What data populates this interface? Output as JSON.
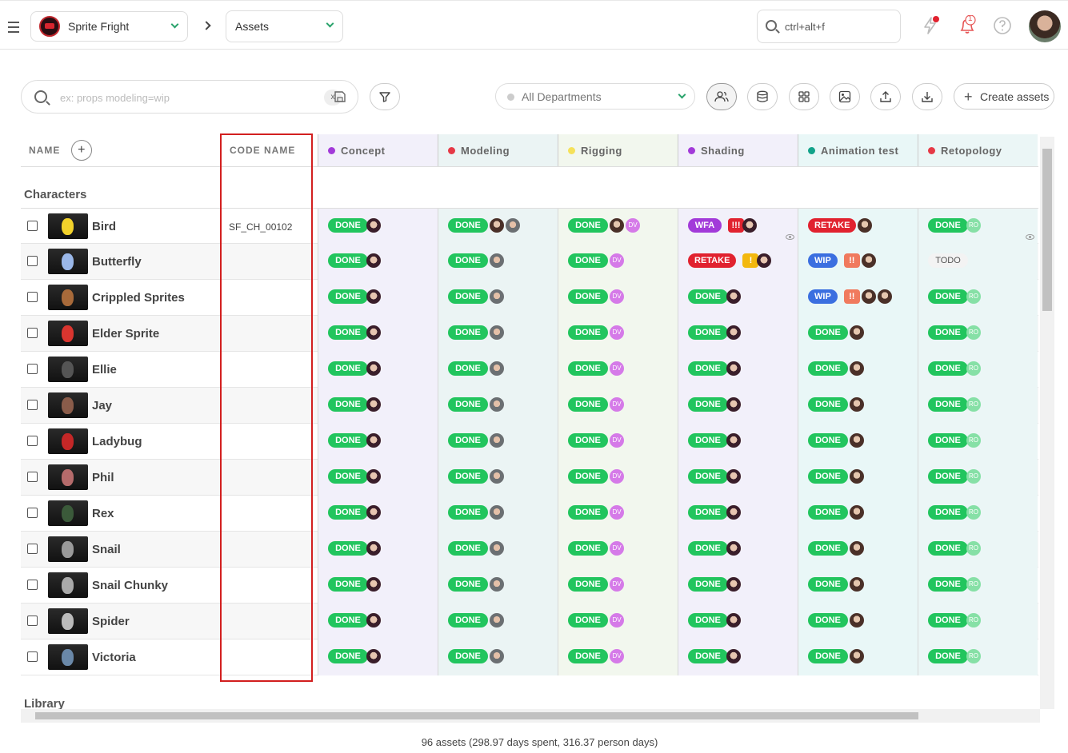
{
  "header": {
    "production": "Sprite Fright",
    "section": "Assets",
    "search_placeholder": "ctrl+alt+f",
    "notification_count": "1"
  },
  "toolbar": {
    "filter_placeholder": "ex: props modeling=wip",
    "clear_label": "x",
    "department": "All Departments",
    "create_label": "Create assets"
  },
  "table": {
    "name_header": "NAME",
    "code_header": "CODE NAME",
    "task_types": [
      {
        "name": "Concept",
        "color": "#a23ad9",
        "bg": "#f2f0fa"
      },
      {
        "name": "Modeling",
        "color": "#e63946",
        "bg": "#ebf4f4"
      },
      {
        "name": "Rigging",
        "color": "#f5e15a",
        "bg": "#f2f7ee"
      },
      {
        "name": "Shading",
        "color": "#a23ad9",
        "bg": "#f2f0fa"
      },
      {
        "name": "Animation test",
        "color": "#12a38a",
        "bg": "#e9f7f7"
      },
      {
        "name": "Retopology",
        "color": "#e63946",
        "bg": "#ebf6f6"
      }
    ],
    "groups": [
      {
        "name": "Characters"
      },
      {
        "name": "Library"
      }
    ],
    "assets": [
      {
        "name": "Bird",
        "code": "SF_CH_00102",
        "thumb": "#f2d22b",
        "tasks": [
          {
            "status": "DONE",
            "avatars": [
              "a"
            ]
          },
          {
            "status": "DONE",
            "avatars": [
              "c",
              "b"
            ]
          },
          {
            "status": "DONE",
            "avatars": [
              "c",
              "DV"
            ]
          },
          {
            "status": "WFA",
            "priority": "!!!",
            "priority_color": "#e1222f",
            "avatars": [
              "a"
            ],
            "eye": true
          },
          {
            "status": "RETAKE",
            "avatars": [
              "c"
            ]
          },
          {
            "status": "DONE",
            "avatars": [
              "RO"
            ],
            "eye": true
          }
        ]
      },
      {
        "name": "Butterfly",
        "code": "",
        "thumb": "#9ab7e8",
        "tasks": [
          {
            "status": "DONE",
            "avatars": [
              "a"
            ]
          },
          {
            "status": "DONE",
            "avatars": [
              "b"
            ]
          },
          {
            "status": "DONE",
            "avatars": [
              "DV"
            ]
          },
          {
            "status": "RETAKE",
            "priority": "!",
            "priority_color": "#f3b80e",
            "avatars": [
              "a"
            ]
          },
          {
            "status": "WIP",
            "priority": "!!",
            "priority_color": "#f07a5e",
            "avatars": [
              "c"
            ]
          },
          {
            "status": "TODO",
            "avatars": []
          }
        ]
      },
      {
        "name": "Crippled Sprites",
        "code": "",
        "thumb": "#a86a3a",
        "tasks": [
          {
            "status": "DONE",
            "avatars": [
              "a"
            ]
          },
          {
            "status": "DONE",
            "avatars": [
              "b"
            ]
          },
          {
            "status": "DONE",
            "avatars": [
              "DV"
            ]
          },
          {
            "status": "DONE",
            "avatars": [
              "a"
            ]
          },
          {
            "status": "WIP",
            "priority": "!!",
            "priority_color": "#f07a5e",
            "avatars": [
              "c",
              "c"
            ]
          },
          {
            "status": "DONE",
            "avatars": [
              "RO"
            ]
          }
        ]
      },
      {
        "name": "Elder Sprite",
        "code": "",
        "thumb": "#d9352f",
        "tasks": [
          {
            "status": "DONE",
            "avatars": [
              "a"
            ]
          },
          {
            "status": "DONE",
            "avatars": [
              "b"
            ]
          },
          {
            "status": "DONE",
            "avatars": [
              "DV"
            ]
          },
          {
            "status": "DONE",
            "avatars": [
              "a"
            ]
          },
          {
            "status": "DONE",
            "avatars": [
              "c"
            ]
          },
          {
            "status": "DONE",
            "avatars": [
              "RO"
            ]
          }
        ]
      },
      {
        "name": "Ellie",
        "code": "",
        "thumb": "#555555",
        "tasks": [
          {
            "status": "DONE",
            "avatars": [
              "a"
            ]
          },
          {
            "status": "DONE",
            "avatars": [
              "b"
            ]
          },
          {
            "status": "DONE",
            "avatars": [
              "DV"
            ]
          },
          {
            "status": "DONE",
            "avatars": [
              "a"
            ]
          },
          {
            "status": "DONE",
            "avatars": [
              "c"
            ]
          },
          {
            "status": "DONE",
            "avatars": [
              "RO"
            ]
          }
        ]
      },
      {
        "name": "Jay",
        "code": "",
        "thumb": "#8a5c4a",
        "tasks": [
          {
            "status": "DONE",
            "avatars": [
              "a"
            ]
          },
          {
            "status": "DONE",
            "avatars": [
              "b"
            ]
          },
          {
            "status": "DONE",
            "avatars": [
              "DV"
            ]
          },
          {
            "status": "DONE",
            "avatars": [
              "a"
            ]
          },
          {
            "status": "DONE",
            "avatars": [
              "c"
            ]
          },
          {
            "status": "DONE",
            "avatars": [
              "RO"
            ]
          }
        ]
      },
      {
        "name": "Ladybug",
        "code": "",
        "thumb": "#c42727",
        "tasks": [
          {
            "status": "DONE",
            "avatars": [
              "a"
            ]
          },
          {
            "status": "DONE",
            "avatars": [
              "b"
            ]
          },
          {
            "status": "DONE",
            "avatars": [
              "DV"
            ]
          },
          {
            "status": "DONE",
            "avatars": [
              "a"
            ]
          },
          {
            "status": "DONE",
            "avatars": [
              "c"
            ]
          },
          {
            "status": "DONE",
            "avatars": [
              "RO"
            ]
          }
        ]
      },
      {
        "name": "Phil",
        "code": "",
        "thumb": "#b56b6b",
        "tasks": [
          {
            "status": "DONE",
            "avatars": [
              "a"
            ]
          },
          {
            "status": "DONE",
            "avatars": [
              "b"
            ]
          },
          {
            "status": "DONE",
            "avatars": [
              "DV"
            ]
          },
          {
            "status": "DONE",
            "avatars": [
              "a"
            ]
          },
          {
            "status": "DONE",
            "avatars": [
              "c"
            ]
          },
          {
            "status": "DONE",
            "avatars": [
              "RO"
            ]
          }
        ]
      },
      {
        "name": "Rex",
        "code": "",
        "thumb": "#3b5a3a",
        "tasks": [
          {
            "status": "DONE",
            "avatars": [
              "a"
            ]
          },
          {
            "status": "DONE",
            "avatars": [
              "b"
            ]
          },
          {
            "status": "DONE",
            "avatars": [
              "DV"
            ]
          },
          {
            "status": "DONE",
            "avatars": [
              "a"
            ]
          },
          {
            "status": "DONE",
            "avatars": [
              "c"
            ]
          },
          {
            "status": "DONE",
            "avatars": [
              "RO"
            ]
          }
        ]
      },
      {
        "name": "Snail",
        "code": "",
        "thumb": "#9a9a9a",
        "tasks": [
          {
            "status": "DONE",
            "avatars": [
              "a"
            ]
          },
          {
            "status": "DONE",
            "avatars": [
              "b"
            ]
          },
          {
            "status": "DONE",
            "avatars": [
              "DV"
            ]
          },
          {
            "status": "DONE",
            "avatars": [
              "a"
            ]
          },
          {
            "status": "DONE",
            "avatars": [
              "c"
            ]
          },
          {
            "status": "DONE",
            "avatars": [
              "RO"
            ]
          }
        ]
      },
      {
        "name": "Snail Chunky",
        "code": "",
        "thumb": "#aaaaaa",
        "tasks": [
          {
            "status": "DONE",
            "avatars": [
              "a"
            ]
          },
          {
            "status": "DONE",
            "avatars": [
              "b"
            ]
          },
          {
            "status": "DONE",
            "avatars": [
              "DV"
            ]
          },
          {
            "status": "DONE",
            "avatars": [
              "a"
            ]
          },
          {
            "status": "DONE",
            "avatars": [
              "c"
            ]
          },
          {
            "status": "DONE",
            "avatars": [
              "RO"
            ]
          }
        ]
      },
      {
        "name": "Spider",
        "code": "",
        "thumb": "#bbbbbb",
        "tasks": [
          {
            "status": "DONE",
            "avatars": [
              "a"
            ]
          },
          {
            "status": "DONE",
            "avatars": [
              "b"
            ]
          },
          {
            "status": "DONE",
            "avatars": [
              "DV"
            ]
          },
          {
            "status": "DONE",
            "avatars": [
              "a"
            ]
          },
          {
            "status": "DONE",
            "avatars": [
              "c"
            ]
          },
          {
            "status": "DONE",
            "avatars": [
              "RO"
            ]
          }
        ]
      },
      {
        "name": "Victoria",
        "code": "",
        "thumb": "#6a88a8",
        "tasks": [
          {
            "status": "DONE",
            "avatars": [
              "a"
            ]
          },
          {
            "status": "DONE",
            "avatars": [
              "b"
            ]
          },
          {
            "status": "DONE",
            "avatars": [
              "DV"
            ]
          },
          {
            "status": "DONE",
            "avatars": [
              "a"
            ]
          },
          {
            "status": "DONE",
            "avatars": [
              "c"
            ]
          },
          {
            "status": "DONE",
            "avatars": [
              "RO"
            ]
          }
        ]
      }
    ]
  },
  "footer": {
    "summary": "96 assets (298.97 days spent, 316.37 person days)"
  },
  "colors": {
    "done": "#22c55e",
    "wfa": "#a23ad9",
    "retake": "#e1222f",
    "wip": "#3b6fe0",
    "highlight": "#d21f1f"
  }
}
